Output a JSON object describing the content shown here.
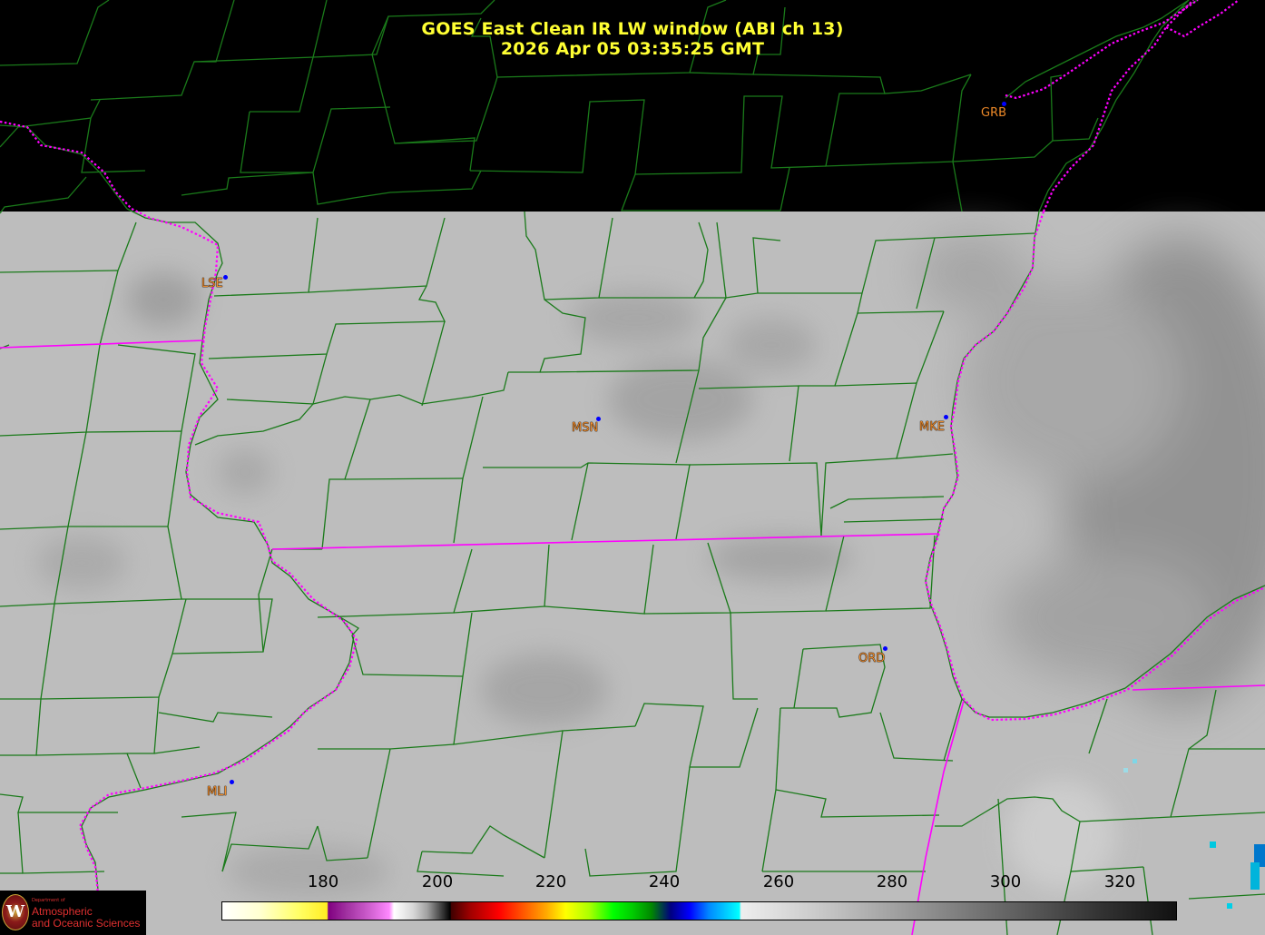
{
  "title": {
    "line1": "GOES East Clean IR LW window (ABI ch 13)",
    "line2": "2026 Apr 05  03:35:25 GMT"
  },
  "stations": [
    {
      "id": "grb",
      "label": "GRB"
    },
    {
      "id": "lse",
      "label": "LSE"
    },
    {
      "id": "msn",
      "label": "MSN"
    },
    {
      "id": "mke",
      "label": "MKE"
    },
    {
      "id": "ord",
      "label": "ORD"
    },
    {
      "id": "mli",
      "label": "MLI"
    }
  ],
  "colorbar": {
    "unit": "",
    "ticks": [
      "180",
      "200",
      "220",
      "240",
      "260",
      "280",
      "300",
      "320"
    ],
    "tick_values": [
      180,
      200,
      220,
      240,
      260,
      280,
      300,
      320
    ],
    "range": [
      162,
      330
    ]
  },
  "logo": {
    "dept": "Department of",
    "line1": "Atmospheric",
    "line2": "and Oceanic Sciences",
    "seal_letter": "W"
  },
  "colors": {
    "title": "#ffff33",
    "county_lines": "#1a7a1a",
    "state_lines": "#ff00ff",
    "station_label": "#ff9933",
    "station_marker": "#0000ff",
    "no_data": "#000000",
    "cloud_gray": "#b9b9b9"
  }
}
